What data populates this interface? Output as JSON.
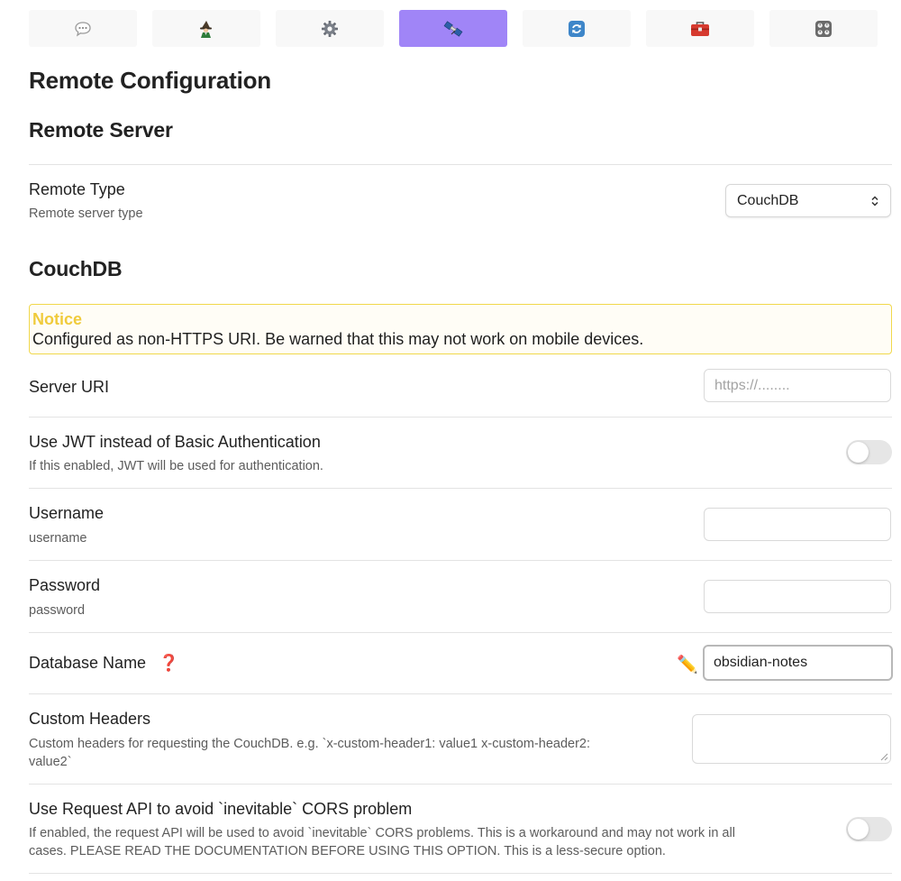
{
  "tabs": [
    {
      "icon": "speech-bubble-icon",
      "active": false
    },
    {
      "icon": "wizard-icon",
      "active": false
    },
    {
      "icon": "gear-icon",
      "active": false
    },
    {
      "icon": "satellite-icon",
      "active": true
    },
    {
      "icon": "sync-arrows-icon",
      "active": false
    },
    {
      "icon": "toolbox-icon",
      "active": false
    },
    {
      "icon": "control-knobs-icon",
      "active": false
    }
  ],
  "page_title": "Remote Configuration",
  "remote_server": {
    "heading": "Remote Server",
    "remote_type": {
      "label": "Remote Type",
      "description": "Remote server type",
      "value": "CouchDB"
    }
  },
  "couchdb": {
    "heading": "CouchDB",
    "notice": {
      "title": "Notice",
      "message": "Configured as non-HTTPS URI. Be warned that this may not work on mobile devices."
    },
    "server_uri": {
      "label": "Server URI",
      "placeholder": "https://........",
      "value": ""
    },
    "use_jwt": {
      "label": "Use JWT instead of Basic Authentication",
      "description": "If this enabled, JWT will be used for authentication.",
      "enabled": false
    },
    "username": {
      "label": "Username",
      "description": "username",
      "value": ""
    },
    "password": {
      "label": "Password",
      "description": "password",
      "value": ""
    },
    "database_name": {
      "label": "Database Name",
      "help_glyph": "❓",
      "edit_glyph": "✏️",
      "value": "obsidian-notes"
    },
    "custom_headers": {
      "label": "Custom Headers",
      "description_line1": "Custom headers for requesting the CouchDB. e.g. `x-custom-header1: value1 x-custom-header2:",
      "description_line2": "value2`",
      "value": ""
    },
    "request_api": {
      "label": "Use Request API to avoid `inevitable` CORS problem",
      "description_line1": "If enabled, the request API will be used to avoid `inevitable` CORS problems. This is a workaround and may not work in all",
      "description_line2": "cases. PLEASE READ THE DOCUMENTATION BEFORE USING THIS OPTION. This is a less-secure option.",
      "enabled": false
    }
  },
  "colors": {
    "active_tab": "#a085f7",
    "notice_border": "#f1d84b",
    "notice_title": "#f0cb3c",
    "help_icon": "#d42020"
  }
}
